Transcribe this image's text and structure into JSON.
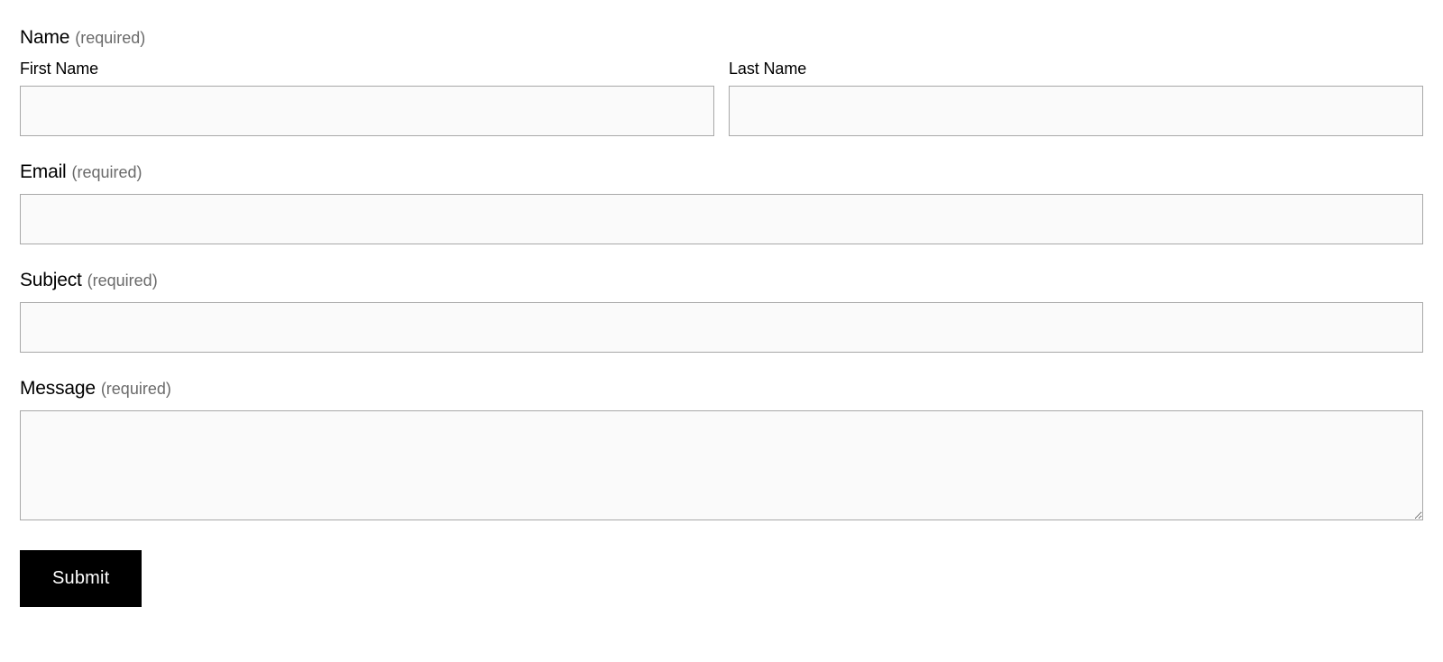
{
  "form": {
    "name": {
      "label": "Name",
      "required_text": "(required)",
      "first_name": {
        "label": "First Name",
        "value": ""
      },
      "last_name": {
        "label": "Last Name",
        "value": ""
      }
    },
    "email": {
      "label": "Email",
      "required_text": "(required)",
      "value": ""
    },
    "subject": {
      "label": "Subject",
      "required_text": "(required)",
      "value": ""
    },
    "message": {
      "label": "Message",
      "required_text": "(required)",
      "value": ""
    },
    "submit": {
      "label": "Submit"
    }
  }
}
